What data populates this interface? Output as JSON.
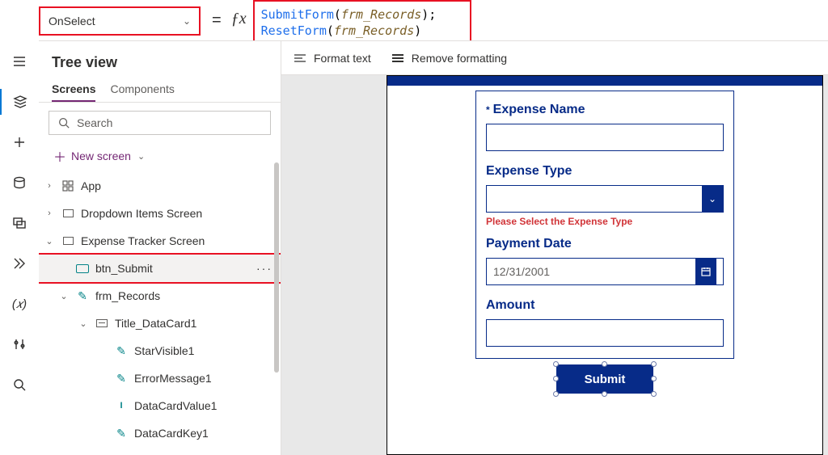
{
  "property_selector": {
    "value": "OnSelect"
  },
  "formula": {
    "line1_fn": "SubmitForm",
    "line1_id": "frm_Records",
    "line2_fn": "ResetForm",
    "line2_id": "frm_Records"
  },
  "format_bar": {
    "format_text": "Format text",
    "remove_formatting": "Remove formatting"
  },
  "tree": {
    "title": "Tree view",
    "tabs": {
      "screens": "Screens",
      "components": "Components"
    },
    "search_placeholder": "Search",
    "new_screen": "New screen",
    "items": [
      {
        "label": "App"
      },
      {
        "label": "Dropdown Items Screen"
      },
      {
        "label": "Expense Tracker Screen"
      },
      {
        "label": "btn_Submit"
      },
      {
        "label": "frm_Records"
      },
      {
        "label": "Title_DataCard1"
      },
      {
        "label": "StarVisible1"
      },
      {
        "label": "ErrorMessage1"
      },
      {
        "label": "DataCardValue1"
      },
      {
        "label": "DataCardKey1"
      }
    ]
  },
  "canvas_form": {
    "expense_name_label": "Expense Name",
    "expense_type_label": "Expense Type",
    "expense_type_error": "Please Select the Expense Type",
    "payment_date_label": "Payment Date",
    "payment_date_value": "12/31/2001",
    "amount_label": "Amount",
    "submit_label": "Submit"
  }
}
